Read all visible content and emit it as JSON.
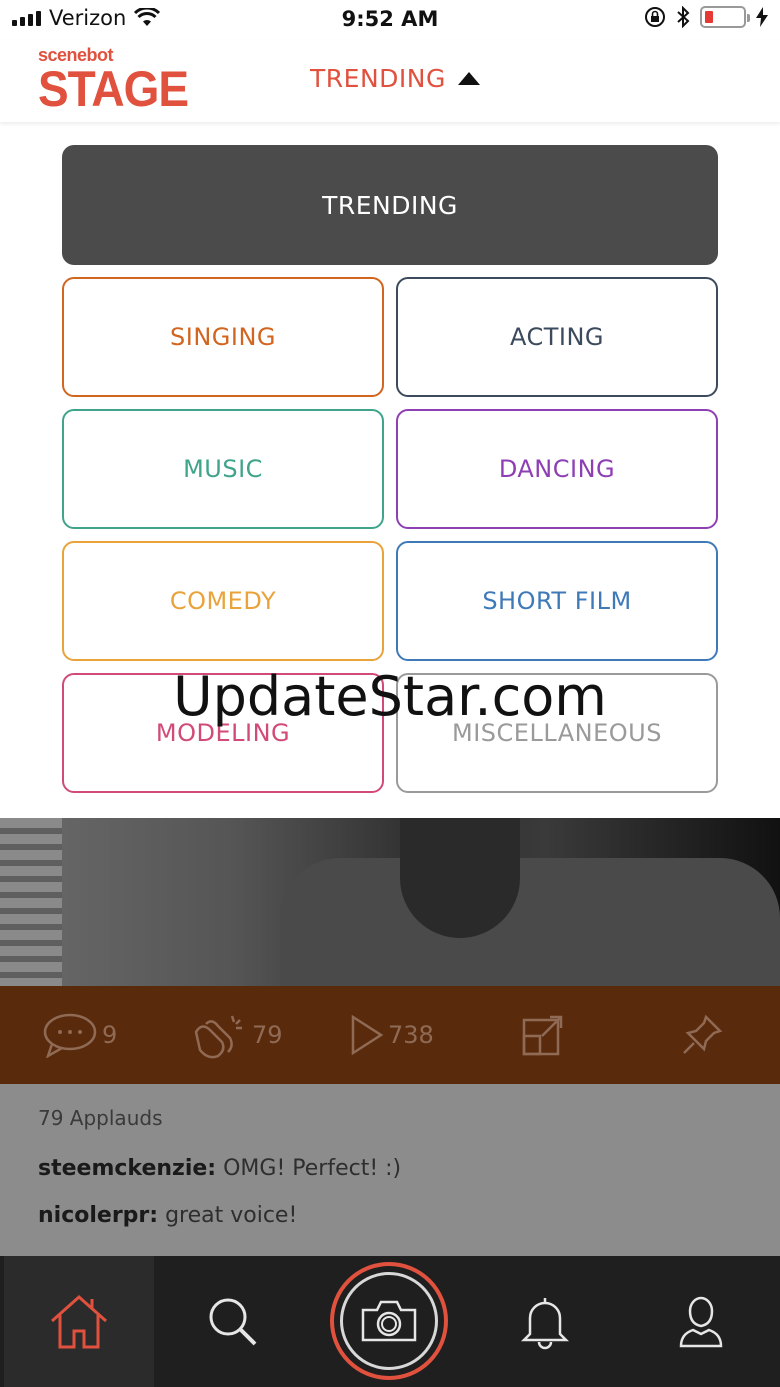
{
  "status_bar": {
    "carrier": "Verizon",
    "time": "9:52 AM"
  },
  "header": {
    "logo_small": "scenebot",
    "logo_big": "STAGE",
    "title": "TRENDING"
  },
  "categories": {
    "trending": "TRENDING",
    "items": [
      {
        "label": "SINGING",
        "color": "#d2651f"
      },
      {
        "label": "ACTING",
        "color": "#3b4a5c"
      },
      {
        "label": "MUSIC",
        "color": "#3fa48a"
      },
      {
        "label": "DANCING",
        "color": "#8e3fb3"
      },
      {
        "label": "COMEDY",
        "color": "#e9a33a"
      },
      {
        "label": "SHORT FILM",
        "color": "#3f7ab8"
      },
      {
        "label": "MODELING",
        "color": "#d24a78"
      },
      {
        "label": "MISCELLANEOUS",
        "color": "#9a9a9a"
      }
    ]
  },
  "watermark": "UpdateStar.com",
  "actions": {
    "comments": "9",
    "applauds": "79",
    "plays": "738"
  },
  "feed": {
    "applauds_text": "79 Applauds",
    "comments": [
      {
        "user": "steemckenzie:",
        "text": "OMG! Perfect! :)"
      },
      {
        "user": "nicolerpr:",
        "text": "great voice!"
      }
    ]
  },
  "colors": {
    "brand": "#e0513e",
    "trending_bg": "#4b4b4b",
    "tab_bar": "#1f1f1f"
  }
}
